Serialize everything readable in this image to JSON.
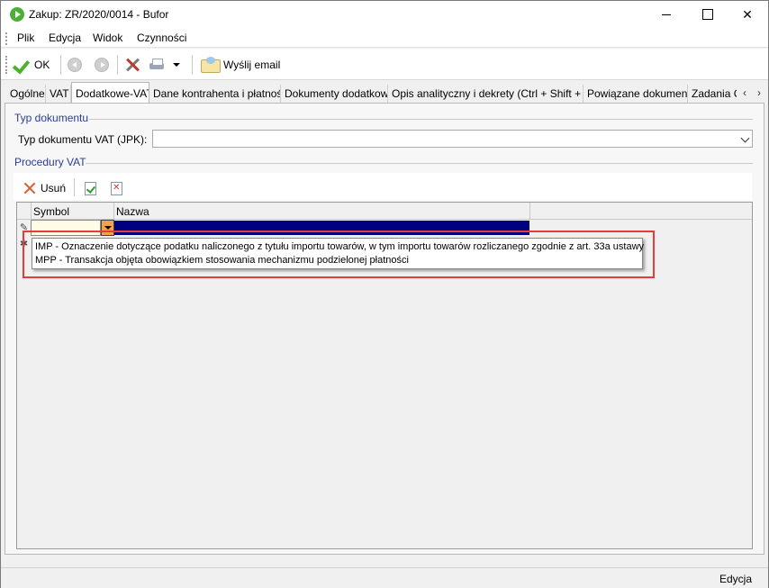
{
  "window": {
    "title": "Zakup: ZR/2020/0014 - Bufor"
  },
  "menu": {
    "items": [
      "Plik",
      "Edycja",
      "Widok",
      "Czynności"
    ]
  },
  "toolbar": {
    "ok_label": "OK",
    "email_label": "Wyślij email"
  },
  "tabs": [
    "Ogólne",
    "VAT",
    "Dodatkowe-VAT",
    "Dane kontrahenta i płatności",
    "Dokumenty dodatkowe",
    "Opis analityczny i dekrety (Ctrl + Shift + D)",
    "Powiązane dokumenty",
    "Zadania C"
  ],
  "active_tab": "Dodatkowe-VAT",
  "typ_dokumentu": {
    "group_title": "Typ dokumentu",
    "field_label": "Typ dokumentu VAT (JPK):",
    "value": ""
  },
  "procedury": {
    "group_title": "Procedury VAT",
    "delete_label": "Usuń",
    "columns": [
      "Symbol",
      "Nazwa"
    ],
    "row_indicator_edit": "✎",
    "row_indicator_new": "✱"
  },
  "dropdown_options": [
    "IMP - Oznaczenie dotyczące podatku naliczonego z tytułu importu towarów, w tym importu towarów rozliczanego zgodnie z art. 33a ustawy",
    "MPP - Transakcja objęta obowiązkiem stosowania mechanizmu podzielonej płatności"
  ],
  "status": {
    "text": "Edycja"
  },
  "colors": {
    "group_title": "#2b3c9a",
    "highlight": "#e63b3b",
    "selected_cell": "#000080"
  }
}
